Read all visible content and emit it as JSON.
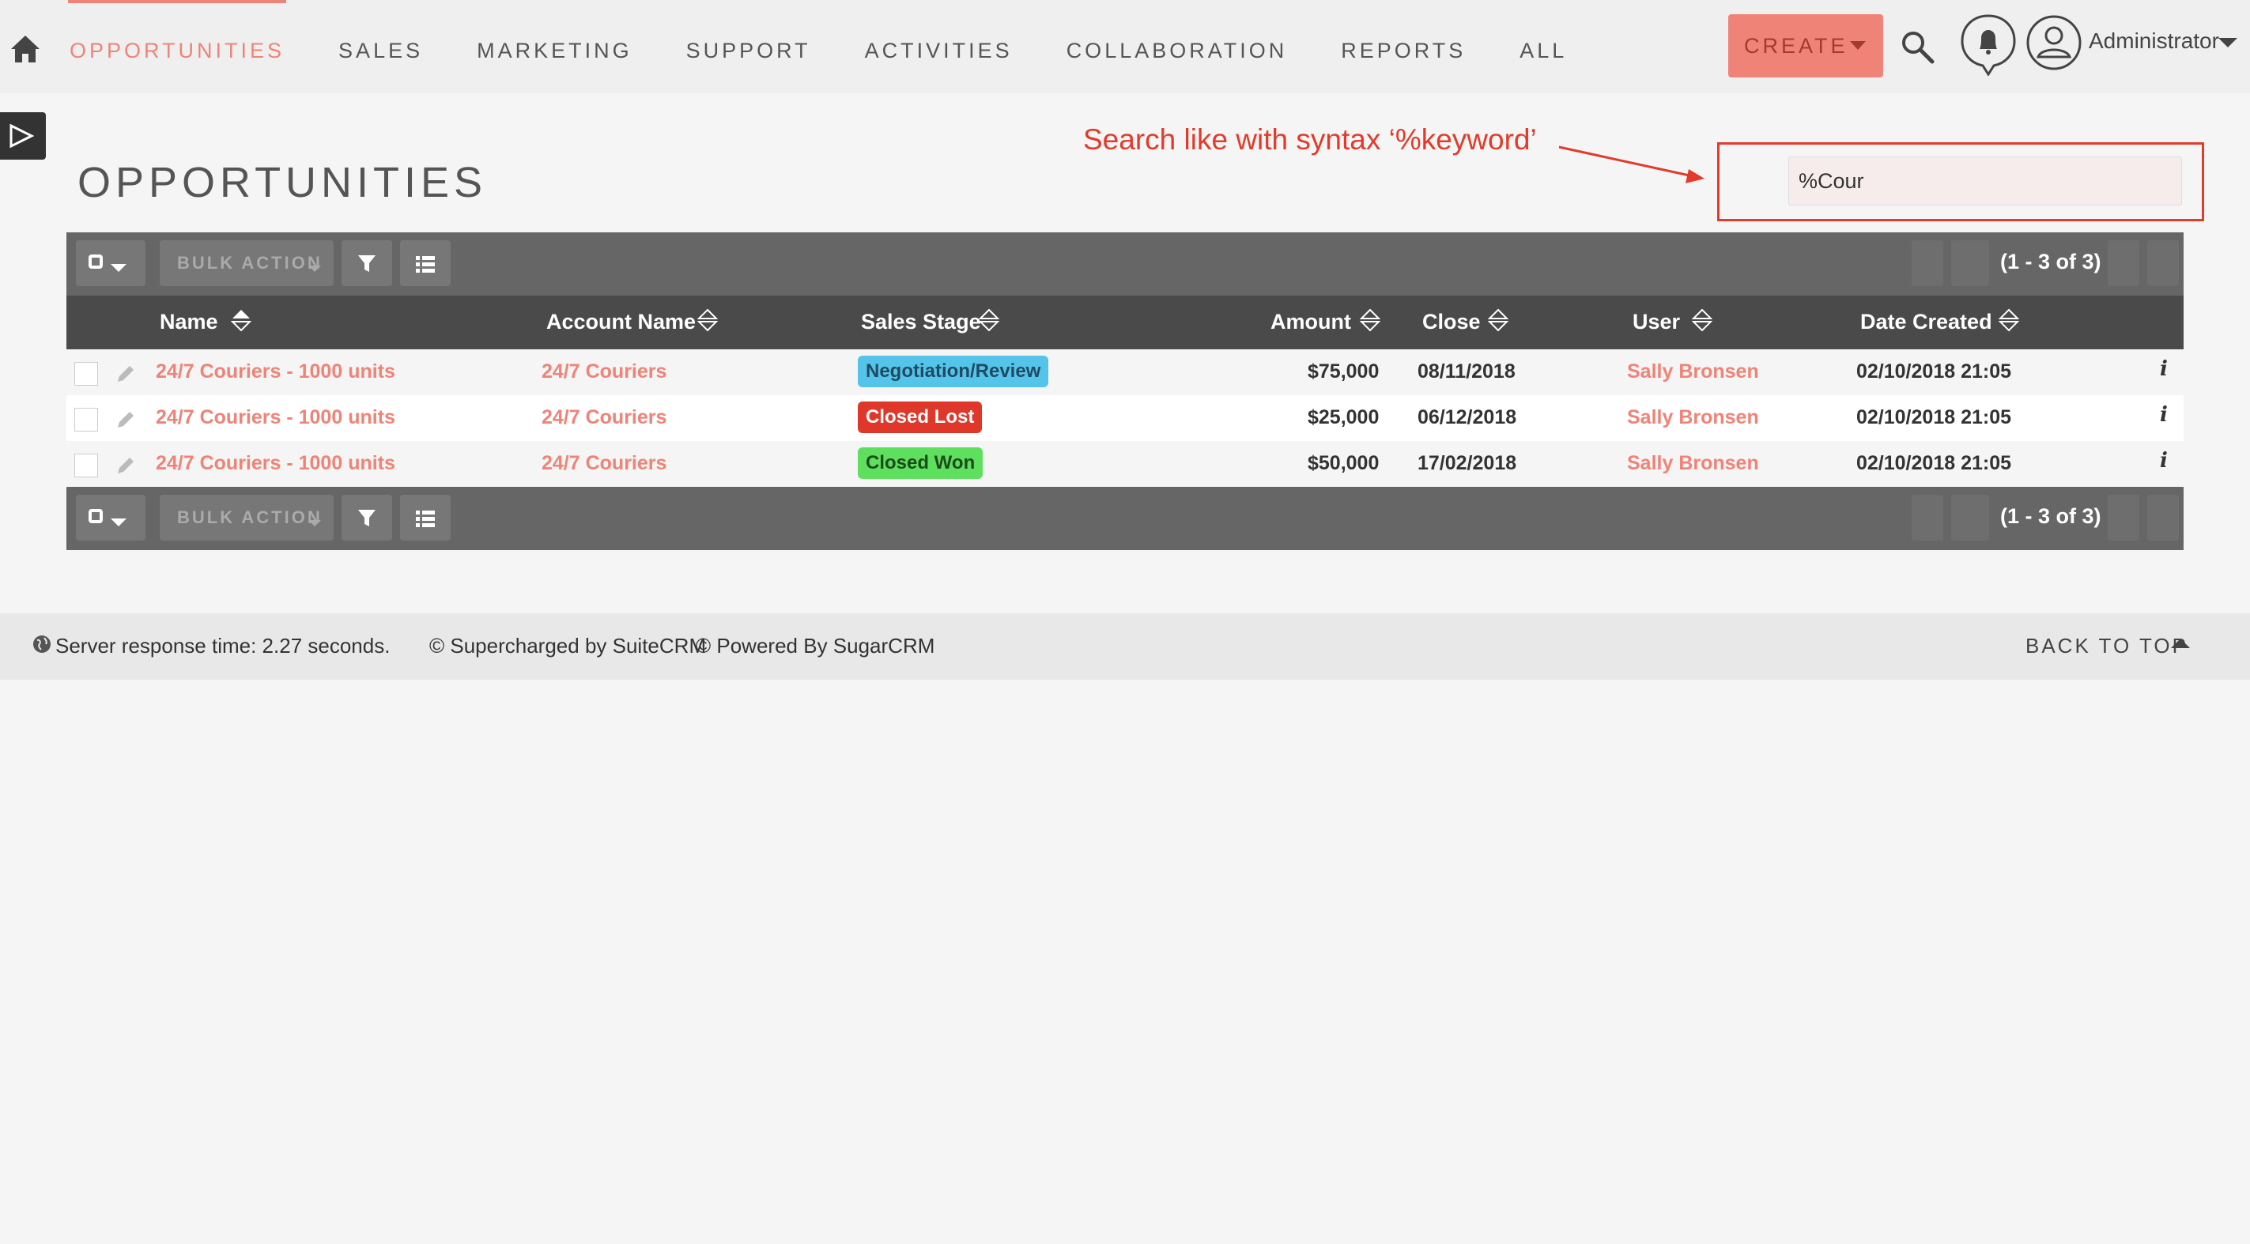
{
  "nav": {
    "items": [
      {
        "label": "OPPORTUNITIES",
        "active": true
      },
      {
        "label": "SALES"
      },
      {
        "label": "MARKETING"
      },
      {
        "label": "SUPPORT"
      },
      {
        "label": "ACTIVITIES"
      },
      {
        "label": "COLLABORATION"
      },
      {
        "label": "REPORTS"
      },
      {
        "label": "ALL"
      }
    ],
    "create_label": "CREATE",
    "user_label": "Administrator",
    "icons": [
      "home-icon",
      "search-icon",
      "bell-icon",
      "user-icon"
    ]
  },
  "page": {
    "title": "OPPORTUNITIES"
  },
  "annotation": {
    "text": "Search like with syntax ‘%keyword’",
    "color": "#e03b2b"
  },
  "search": {
    "value": "%Cour"
  },
  "toolbar": {
    "bulk_action_label": "BULK ACTION",
    "pagination": "(1 - 3 of 3)"
  },
  "table": {
    "columns": [
      "Name",
      "Account Name",
      "Sales Stage",
      "Amount",
      "Close",
      "User",
      "Date Created"
    ],
    "rows": [
      {
        "name": "24/7 Couriers - 1000 units",
        "account": "24/7 Couriers",
        "stage": "Negotiation/Review",
        "stage_color": "#55c4ea",
        "stage_text_color": "#1f4a63",
        "amount": "$75,000",
        "close": "08/11/2018",
        "user": "Sally Bronsen",
        "date_created": "02/10/2018 21:05",
        "info": "i"
      },
      {
        "name": "24/7 Couriers - 1000 units",
        "account": "24/7 Couriers",
        "stage": "Closed Lost",
        "stage_color": "#e0372b",
        "stage_text_color": "#ffffff",
        "amount": "$25,000",
        "close": "06/12/2018",
        "user": "Sally Bronsen",
        "date_created": "02/10/2018 21:05",
        "info": "i"
      },
      {
        "name": "24/7 Couriers - 1000 units",
        "account": "24/7 Couriers",
        "stage": "Closed Won",
        "stage_color": "#5ee05e",
        "stage_text_color": "#1d4a1d",
        "amount": "$50,000",
        "close": "17/02/2018",
        "user": "Sally Bronsen",
        "date_created": "02/10/2018 21:05",
        "info": "i"
      }
    ]
  },
  "footer": {
    "response_time": "Server response time: 2.27 seconds.",
    "supercharged": "© Supercharged by SuiteCRM",
    "powered": "© Powered By SugarCRM",
    "back_to_top": "BACK TO TOP"
  },
  "colors": {
    "accent": "#f08377",
    "toolbar": "#666666",
    "header": "#4a4a4a"
  }
}
